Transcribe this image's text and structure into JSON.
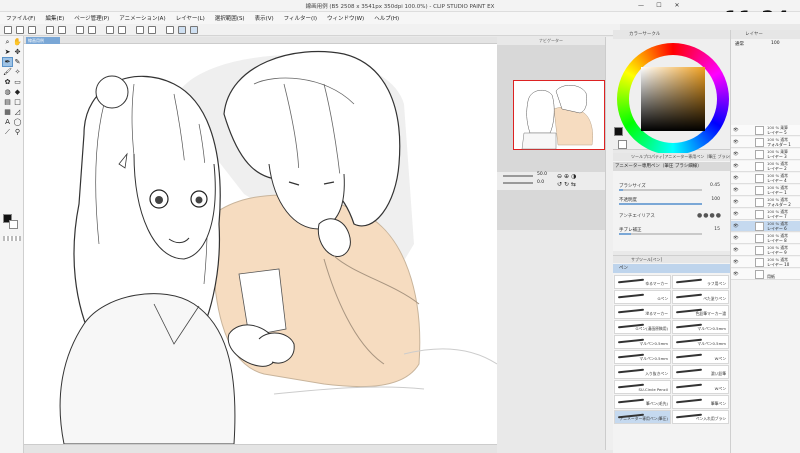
{
  "window": {
    "title": "線画用例 (B5 2508 x 3541px 350dpi 100.0%) - CLIP STUDIO PAINT EX",
    "clock": "11:24",
    "minimize": "—",
    "maximize": "☐",
    "close": "✕"
  },
  "menu": [
    "ファイル(F)",
    "編集(E)",
    "ページ管理(P)",
    "アニメーション(A)",
    "レイヤー(L)",
    "選択範囲(S)",
    "表示(V)",
    "フィルター(I)",
    "ウィンドウ(W)",
    "ヘルプ(H)"
  ],
  "canvas": {
    "tab_label": "線画用例"
  },
  "navigator": {
    "header": "ナビゲーター",
    "zoom": "50.0",
    "angle": "0.0"
  },
  "color_panel": {
    "header": "カラーサークル",
    "main_color": "#111111",
    "sub_color": "#ffffff"
  },
  "tool_property": {
    "header": "ツールプロパティ[アニメーター専用ペン（筆圧 ブラシ細線）]",
    "tool_name": "アニメーター専用ペン（筆圧 ブラシ細線）",
    "rows": [
      {
        "label": "ブラシサイズ",
        "value": "0.45",
        "fill": 0.05
      },
      {
        "label": "不透明度",
        "value": "100",
        "fill": 1.0
      },
      {
        "label": "アンチエイリアス",
        "value": ""
      },
      {
        "label": "手ブレ補正",
        "value": "15",
        "fill": 0.15
      }
    ]
  },
  "sub_tool": {
    "header": "サブツール[ペン]",
    "group": "ペン",
    "brushes": [
      "ゆるマーカー",
      "ラフ用ペン",
      "Gペン",
      "ぺた塗りペン",
      "滲るマーカー",
      "色鉛筆マーカー濃",
      "Gペン(漫画原稿用)",
      "マルペン0.5mm",
      "マルペン0.5mm",
      "マルペン0.5mm",
      "マルペン0.5mm",
      "Wペン",
      "入り抜きペン",
      "濃い鉛筆",
      "SU-Circle Pencil",
      "Wペン",
      "筆ペン(毛先)",
      "筆筆ペン",
      "アニメーター専用ペン(筆圧)",
      "ペン入れ用ブラシ"
    ],
    "selected_index": 18
  },
  "layer_panel": {
    "header": "レイヤー",
    "blend_mode": "通常",
    "opacity": "100",
    "layers": [
      {
        "l1": "100 % 乗算",
        "l2": "レイヤー 5",
        "eye": "👁"
      },
      {
        "l1": "100 % 通常",
        "l2": "フォルダー 1",
        "eye": "👁"
      },
      {
        "l1": "100 % 乗算",
        "l2": "レイヤー 3",
        "eye": "👁"
      },
      {
        "l1": "100 % 通常",
        "l2": "レイヤー 2",
        "eye": "👁"
      },
      {
        "l1": "100 % 通常",
        "l2": "レイヤー 4",
        "eye": "👁"
      },
      {
        "l1": "100 % 通常",
        "l2": "レイヤー 1",
        "eye": "👁"
      },
      {
        "l1": "100 % 通常",
        "l2": "フォルダー 2",
        "eye": "👁"
      },
      {
        "l1": "100 % 通常",
        "l2": "レイヤー 7",
        "eye": "👁"
      },
      {
        "l1": "100 % 通常",
        "l2": "レイヤー 6",
        "eye": "👁"
      },
      {
        "l1": "100 % 通常",
        "l2": "レイヤー 8",
        "eye": "👁"
      },
      {
        "l1": "100 % 通常",
        "l2": "レイヤー 9",
        "eye": "👁"
      },
      {
        "l1": "100 % 通常",
        "l2": "レイヤー 10",
        "eye": "👁"
      },
      {
        "l1": "",
        "l2": "用紙",
        "eye": "👁"
      }
    ],
    "selected_index": 8
  }
}
